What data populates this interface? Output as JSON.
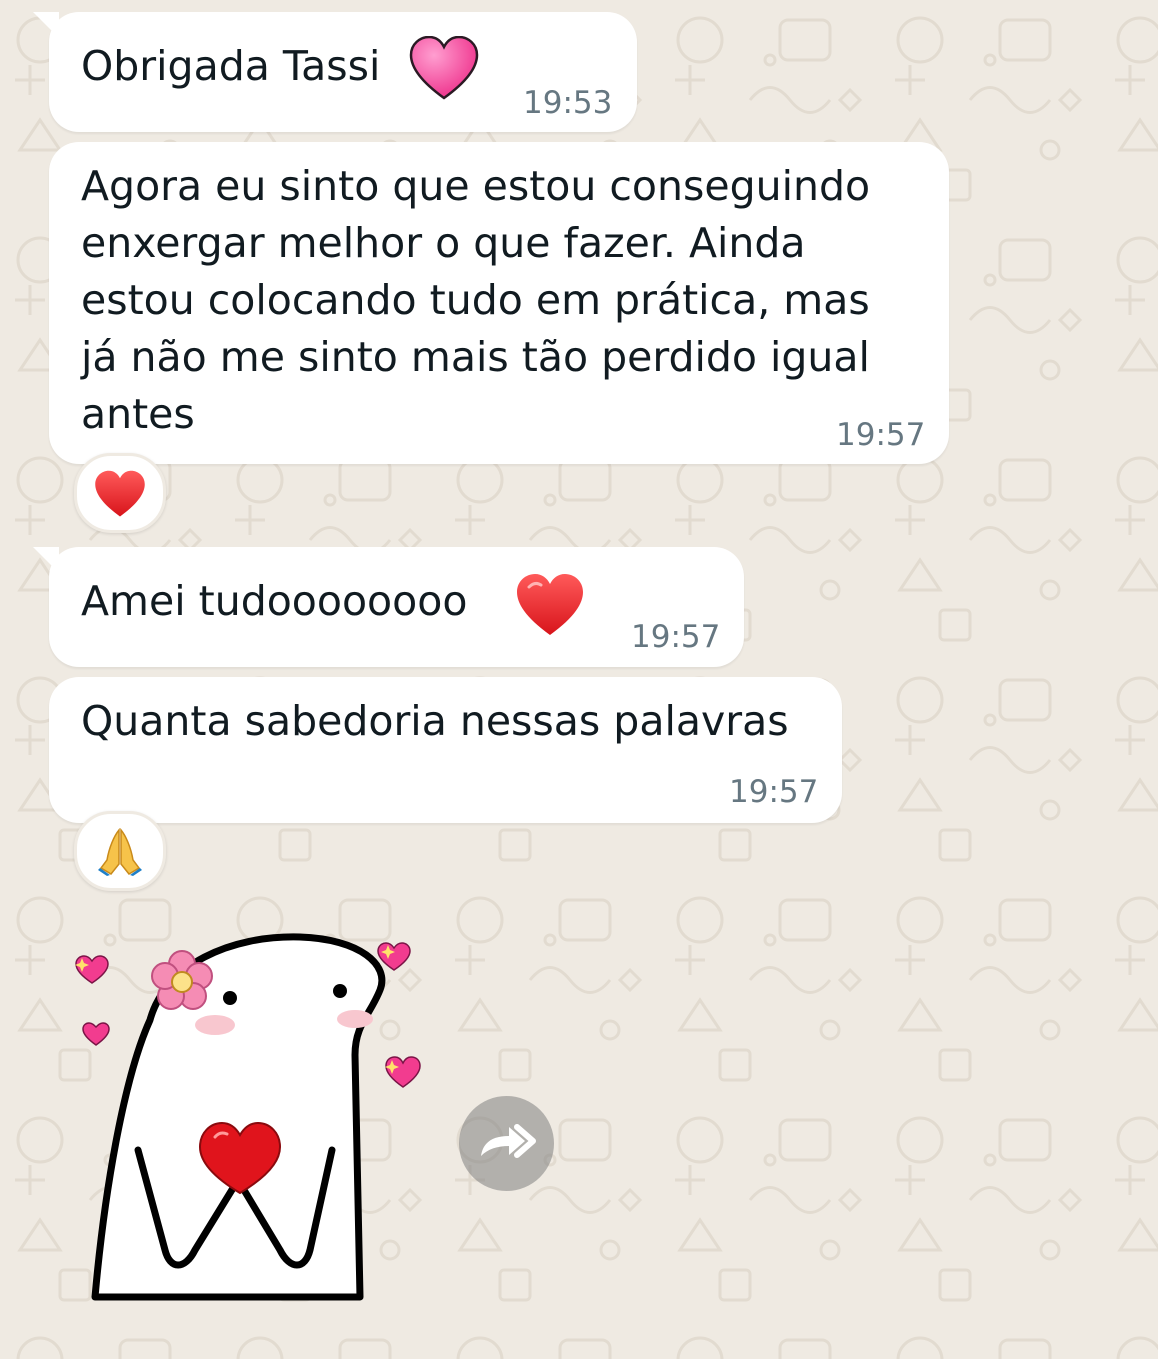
{
  "messages": [
    {
      "text": "Obrigada Tassi",
      "time": "19:53",
      "emoji": "pink-heart"
    },
    {
      "text": "Agora eu sinto que estou conseguindo\nenxergar melhor o que fazer. Ainda\nestou colocando tudo em prática, mas\njá não me sinto mais tão perdido igual\nantes",
      "time": "19:57",
      "reaction": "red-heart"
    },
    {
      "text": "Amei tudoooooooo",
      "time": "19:57",
      "emoji": "red-heart"
    },
    {
      "text": "Quanta sabedoria nessas palavras",
      "time": "19:57",
      "reaction": "folded-hands"
    }
  ],
  "sticker": {
    "name": "flork-with-heart-sticker"
  },
  "forward_button": {
    "icon": "forward-icon"
  },
  "colors": {
    "background": "#efeae2",
    "bubble": "#ffffff",
    "text": "#111b21",
    "timestamp": "#667781"
  }
}
